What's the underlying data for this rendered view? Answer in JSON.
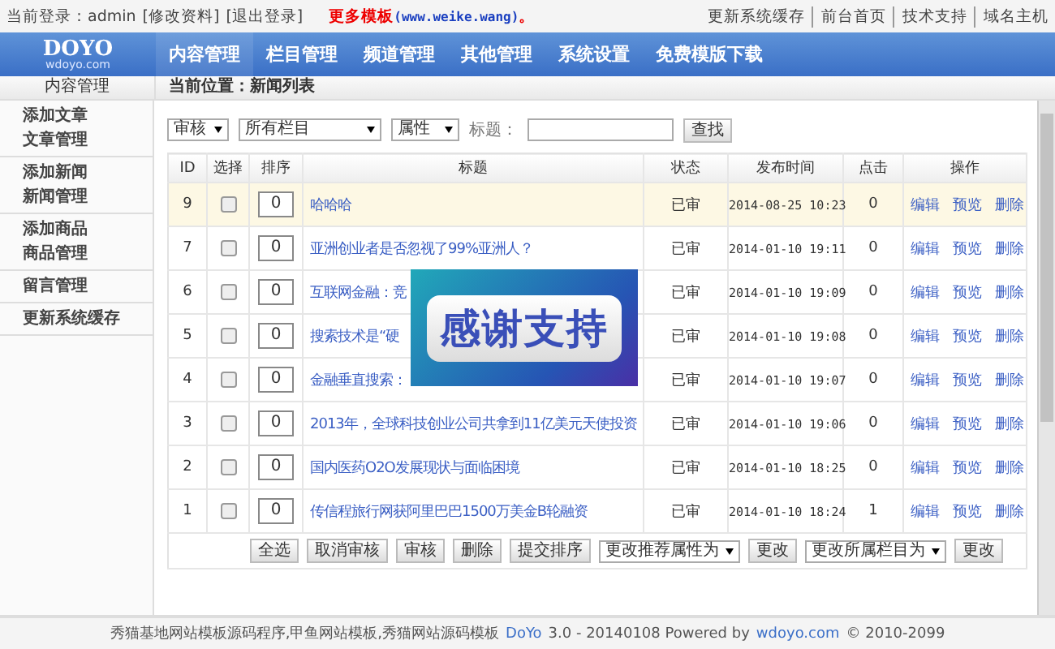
{
  "top_bar": {
    "login_label": "当前登录：admin",
    "links_left": [
      "[修改资料]",
      "[退出登录]"
    ],
    "promo": "更多模板",
    "promo_url": "(www.weike.wang)",
    "promo_end": "。",
    "links_right": [
      "更新系统缓存",
      "前台首页",
      "技术支持",
      "域名主机"
    ]
  },
  "logo": {
    "name": "DOYO",
    "sub": "wdoyo.com"
  },
  "nav": [
    {
      "label": "内容管理",
      "selected": true
    },
    {
      "label": "栏目管理",
      "selected": false
    },
    {
      "label": "频道管理",
      "selected": false
    },
    {
      "label": "其他管理",
      "selected": false
    },
    {
      "label": "系统设置",
      "selected": false
    },
    {
      "label": "免费模版下载",
      "selected": false
    }
  ],
  "sidebar": {
    "title": "内容管理",
    "groups": [
      [
        "添加文章",
        "文章管理"
      ],
      [
        "添加新闻",
        "新闻管理"
      ],
      [
        "添加商品",
        "商品管理"
      ],
      [
        "留言管理"
      ],
      [
        "更新系统缓存"
      ]
    ]
  },
  "breadcrumb": "当前位置：新闻列表",
  "filters": {
    "selects": [
      "审核",
      "所有栏目",
      "属性"
    ],
    "title_label": "标题：",
    "search_button": "查找"
  },
  "table": {
    "columns": [
      "ID",
      "选择",
      "排序",
      "标题",
      "状态",
      "发布时间",
      "点击",
      "操作"
    ],
    "rows": [
      {
        "id": "9",
        "checked": false,
        "order": "0",
        "title": "哈哈哈",
        "status": "已审",
        "time": "2014-08-25 10:23",
        "clicks": "0",
        "selected": true,
        "actions": [
          "编辑",
          "预览",
          "删除"
        ]
      },
      {
        "id": "7",
        "checked": false,
        "order": "0",
        "title": "亚洲创业者是否忽视了99%亚洲人？",
        "status": "已审",
        "time": "2014-01-10 19:11",
        "clicks": "0",
        "selected": false,
        "actions": [
          "编辑",
          "预览",
          "删除"
        ]
      },
      {
        "id": "6",
        "checked": false,
        "order": "0",
        "title": "互联网金融：竞",
        "status": "已审",
        "time": "2014-01-10 19:09",
        "clicks": "0",
        "selected": false,
        "actions": [
          "编辑",
          "预览",
          "删除"
        ]
      },
      {
        "id": "5",
        "checked": false,
        "order": "0",
        "title": "搜索技术是“硬",
        "status": "已审",
        "time": "2014-01-10 19:08",
        "clicks": "0",
        "selected": false,
        "actions": [
          "编辑",
          "预览",
          "删除"
        ]
      },
      {
        "id": "4",
        "checked": false,
        "order": "0",
        "title": "金融垂直搜索：",
        "status": "已审",
        "time": "2014-01-10 19:07",
        "clicks": "0",
        "selected": false,
        "actions": [
          "编辑",
          "预览",
          "删除"
        ]
      },
      {
        "id": "3",
        "checked": false,
        "order": "0",
        "title": "2013年，全球科技创业公司共拿到11亿美元天使投资",
        "status": "已审",
        "time": "2014-01-10 19:06",
        "clicks": "0",
        "selected": false,
        "actions": [
          "编辑",
          "预览",
          "删除"
        ]
      },
      {
        "id": "2",
        "checked": false,
        "order": "0",
        "title": "国内医药O2O发展现状与面临困境",
        "status": "已审",
        "time": "2014-01-10 18:25",
        "clicks": "0",
        "selected": false,
        "actions": [
          "编辑",
          "预览",
          "删除"
        ]
      },
      {
        "id": "1",
        "checked": false,
        "order": "0",
        "title": "传信程旅行网获阿里巴巴1500万美金B轮融资",
        "status": "已审",
        "time": "2014-01-10 18:24",
        "clicks": "1",
        "selected": false,
        "actions": [
          "编辑",
          "预览",
          "删除"
        ]
      }
    ],
    "bottom_buttons": [
      "全选",
      "取消审核",
      "审核",
      "删除",
      "提交排序"
    ],
    "bottom_select_1": "更改推荐属性为",
    "change_1": "更改",
    "bottom_select_2": "更改所属栏目为",
    "change_2": "更改"
  },
  "footer": {
    "text": "秀猫基地网站模板源码程序,甲鱼网站模板,秀猫网站源码模板",
    "brand": "DoYo",
    "version": "3.0 - 20140108 Powered by",
    "link": "wdoyo.com",
    "copyright": "© 2010-2099"
  },
  "popup": {
    "text": "感谢支持"
  }
}
